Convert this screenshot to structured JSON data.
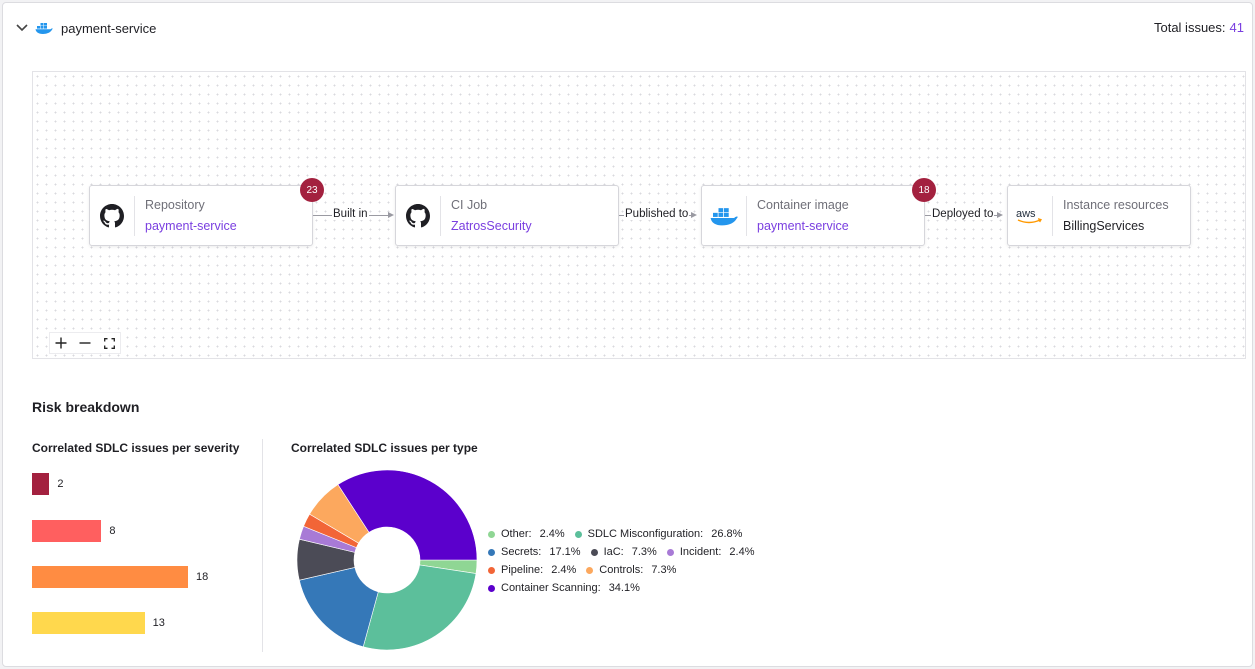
{
  "header": {
    "service_name": "payment-service",
    "total_label": "Total issues:",
    "total_value": "41"
  },
  "pipeline": {
    "nodes": [
      {
        "kind": "Repository",
        "value": "payment-service",
        "icon": "github-icon",
        "badge": "23"
      },
      {
        "kind": "CI Job",
        "value": "ZatrosSecurity",
        "icon": "github-icon",
        "badge": ""
      },
      {
        "kind": "Container image",
        "value": "payment-service",
        "icon": "docker-icon",
        "badge": "18"
      },
      {
        "kind": "Instance resources",
        "value": "BillingServices",
        "icon": "aws-icon",
        "badge": ""
      }
    ],
    "edges": [
      "Built in",
      "Published to",
      "Deployed to"
    ],
    "aws_text": "aws"
  },
  "zoom": {
    "in": "zoom-in-icon",
    "out": "zoom-out-icon",
    "fit": "fit-view-icon"
  },
  "risk": {
    "title": "Risk breakdown",
    "severity_title": "Correlated SDLC issues per severity",
    "type_title": "Correlated SDLC issues per type"
  },
  "severity_bars": [
    {
      "value": 2,
      "label": "2",
      "color": "#a3213f"
    },
    {
      "value": 8,
      "label": "8",
      "color": "#ff5f5f"
    },
    {
      "value": 18,
      "label": "18",
      "color": "#ff8c42"
    },
    {
      "value": 13,
      "label": "13",
      "color": "#ffd84d"
    }
  ],
  "chart_data": {
    "type": "pie",
    "title": "Correlated SDLC issues per type",
    "donut": true,
    "slices": [
      {
        "name": "Other",
        "percent": 2.4,
        "label": "2.4%",
        "color": "#8fd694"
      },
      {
        "name": "SDLC Misconfiguration",
        "percent": 26.8,
        "label": "26.8%",
        "color": "#5cbf9b"
      },
      {
        "name": "Secrets",
        "percent": 17.1,
        "label": "17.1%",
        "color": "#3578b8"
      },
      {
        "name": "IaC",
        "percent": 7.3,
        "label": "7.3%",
        "color": "#4b4b56"
      },
      {
        "name": "Incident",
        "percent": 2.4,
        "label": "2.4%",
        "color": "#a87ad6"
      },
      {
        "name": "Pipeline",
        "percent": 2.4,
        "label": "2.4%",
        "color": "#f26537"
      },
      {
        "name": "Controls",
        "percent": 7.3,
        "label": "7.3%",
        "color": "#fca85e"
      },
      {
        "name": "Container Scanning",
        "percent": 34.1,
        "label": "34.1%",
        "color": "#5b00cc"
      }
    ],
    "legend_rows": [
      [
        0,
        1
      ],
      [
        2,
        3,
        4
      ],
      [
        5,
        6
      ],
      [
        7
      ]
    ]
  }
}
